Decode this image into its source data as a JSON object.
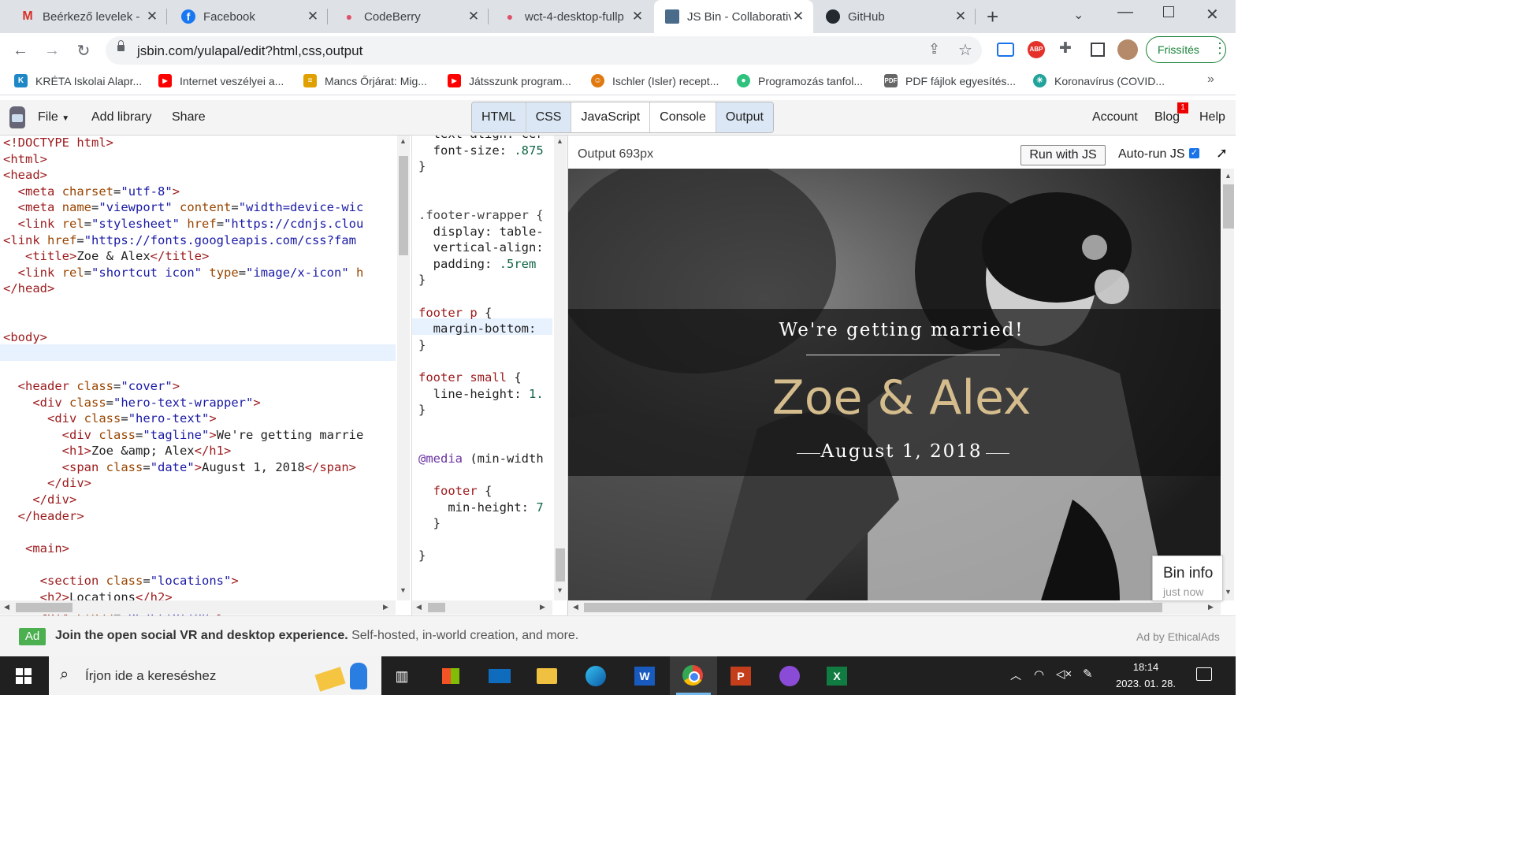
{
  "tabs": [
    {
      "title": "Beérkező levelek - ",
      "icon": "gmail-icon",
      "color": "#d93025",
      "glyph": "M"
    },
    {
      "title": "Facebook",
      "icon": "facebook-icon",
      "color": "#1877f2",
      "glyph": "f"
    },
    {
      "title": "CodeBerry",
      "icon": "codeberry-icon",
      "color": "#e0506a",
      "glyph": "●"
    },
    {
      "title": "wct-4-desktop-fullp",
      "icon": "codeberry-icon",
      "color": "#e0506a",
      "glyph": "●"
    },
    {
      "title": "JS Bin - Collaborativ",
      "icon": "jsbin-icon",
      "color": "#4a6b8a",
      "glyph": "▣"
    },
    {
      "title": "GitHub",
      "icon": "github-icon",
      "color": "#24292f",
      "glyph": "●"
    }
  ],
  "omnibox": {
    "url": "jsbin.com/yulapal/edit?html,css,output",
    "update_label": "Frissítés"
  },
  "bookmarks": [
    {
      "label": "KRÉTA Iskolai Alapr...",
      "color": "#1e88c7",
      "glyph": "K"
    },
    {
      "label": "Internet veszélyei a...",
      "color": "#ff0000",
      "glyph": "▶"
    },
    {
      "label": "Mancs Őrjárat: Mig...",
      "color": "#e0a000",
      "glyph": "≡"
    },
    {
      "label": "Játsszunk program...",
      "color": "#ff0000",
      "glyph": "▶"
    },
    {
      "label": "Ischler (Isler) recept...",
      "color": "#e07a10",
      "glyph": "☺"
    },
    {
      "label": "Programozás tanfol...",
      "color": "#2ec27e",
      "glyph": "●"
    },
    {
      "label": "PDF fájlok egyesítés...",
      "color": "#666666",
      "glyph": "P"
    },
    {
      "label": "Koronavírus (COVID...",
      "color": "#1fa39a",
      "glyph": "✳"
    }
  ],
  "jsbin": {
    "file": "File",
    "add_library": "Add library",
    "share": "Share",
    "panels": [
      "HTML",
      "CSS",
      "JavaScript",
      "Console",
      "Output"
    ],
    "account": "Account",
    "blog": "Blog",
    "blog_badge": "1",
    "help": "Help"
  },
  "output": {
    "label": "Output 693px",
    "run_button": "Run with JS",
    "autorun": "Auto-run JS",
    "tagline": "We're getting married!",
    "names": "Zoe & Alex",
    "date": "August 1, 2018",
    "bin_info": "Bin info",
    "bin_time": "just now"
  },
  "ad": {
    "badge": "Ad",
    "headline": "Join the open social VR and desktop experience.",
    "text": "Self-hosted, in-world creation, and more.",
    "by": "Ad by EthicalAds"
  },
  "taskbar": {
    "search_placeholder": "Írjon ide a kereséshez",
    "time": "18:14",
    "date": "2023. 01. 28."
  }
}
